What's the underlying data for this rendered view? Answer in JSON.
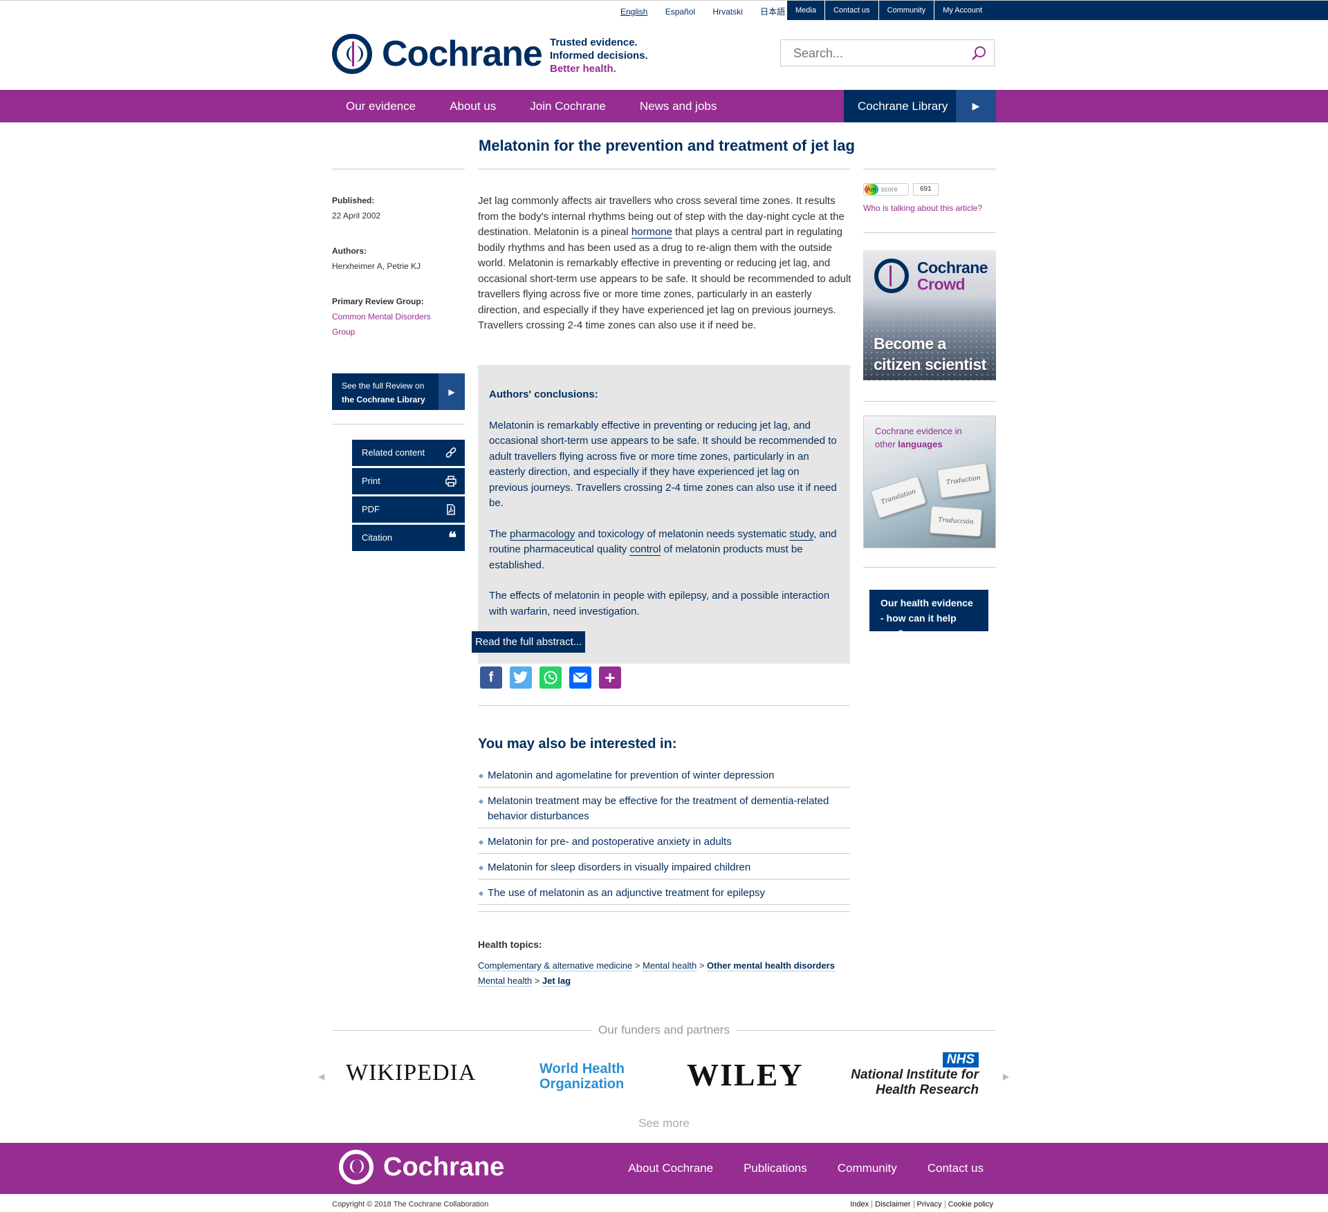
{
  "languages": [
    "English",
    "Español",
    "Hrvatski",
    "日本語"
  ],
  "utility_links": [
    "Media",
    "Contact us",
    "Community",
    "My Account"
  ],
  "header": {
    "brand": "Cochrane",
    "tagline": [
      "Trusted evidence.",
      "Informed decisions.",
      "Better health."
    ],
    "search_placeholder": "Search..."
  },
  "nav": {
    "items": [
      "Our evidence",
      "About us",
      "Join Cochrane",
      "News and jobs"
    ],
    "library": "Cochrane Library"
  },
  "article": {
    "title": "Melatonin for the prevention and treatment of jet lag",
    "published_label": "Published:",
    "published": "22 April 2002",
    "authors_label": "Authors:",
    "authors": "Herxheimer A, Petrie KJ",
    "group_label": "Primary Review Group:",
    "group": "Common Mental Disorders Group",
    "lede_1": "Jet lag commonly affects air travellers who cross several time zones. It results from the body's internal rhythms being out of step with the day-night cycle at the destination. Melatonin is a pineal ",
    "lede_link": "hormone",
    "lede_2": " that plays a central part in regulating bodily rhythms and has been used as a drug to re-align them with the outside world. Melatonin is remarkably effective in preventing or reducing jet lag, and occasional short-term use appears to be safe. It should be recommended to adult travellers flying across five or more time zones, particularly in an easterly direction, and especially if they have experienced jet lag on previous journeys. Travellers crossing 2-4 time zones can also use it if need be."
  },
  "full_review": {
    "line1": "See the full Review on",
    "line2": "the Cochrane Library"
  },
  "tools": [
    "Related content",
    "Print",
    "PDF",
    "Citation"
  ],
  "abstract": {
    "heading": "Authors' conclusions:",
    "p1": "Melatonin is remarkably effective in preventing or reducing jet lag, and occasional short-term use appears to be safe. It should be recommended to adult travellers flying across five or more time zones, particularly in an easterly direction, and especially if they have experienced jet lag on previous journeys. Travellers crossing 2-4 time zones can also use it if need be.",
    "p2_a": "The ",
    "p2_l1": "pharmacology",
    "p2_b": " and toxicology of melatonin needs systematic ",
    "p2_l2": "study",
    "p2_c": ", and routine pharmaceutical quality ",
    "p2_l3": "control",
    "p2_d": " of melatonin products must be established.",
    "p3": "The effects of melatonin in people with epilepsy, and a possible interaction with warfarin, need investigation.",
    "read_more": "Read the full abstract..."
  },
  "interest": {
    "heading": "You may also be interested in:",
    "items": [
      "Melatonin and agomelatine for prevention of winter depression",
      "Melatonin treatment may be effective for the treatment of dementia-related behavior disturbances",
      "Melatonin for pre- and postoperative anxiety in adults",
      "Melatonin for sleep disorders in visually impaired children",
      "The use of melatonin as an adjunctive treatment for epilepsy"
    ]
  },
  "topics": {
    "heading": "Health topics:",
    "row1": [
      "Complementary & alternative medicine",
      "Mental health",
      "Other mental health disorders"
    ],
    "row2": [
      "Mental health",
      "Jet lag"
    ],
    "separator": ">"
  },
  "altmetric": {
    "am": "Am",
    "label": "score",
    "score": "691",
    "question": "Who is talking about this article?"
  },
  "crowd": {
    "brand1": "Cochrane",
    "brand2": "Crowd",
    "line1": "Become a",
    "line2": "citizen scientist"
  },
  "languages_box": {
    "line1": "Cochrane evidence in",
    "line2a": "other ",
    "line2b": "languages",
    "pieces": [
      "Translation",
      "Traduction",
      "Traducción"
    ]
  },
  "help_button": "Our health evidence - how can it help you?",
  "funders": {
    "heading": "Our funders and partners",
    "wikipedia": "WIKIPEDIA",
    "who_1": "World Health",
    "who_2": "Organization",
    "wiley": "WILEY",
    "nhs": "NHS",
    "nihr_1": "National Institute for",
    "nihr_2": "Health Research",
    "see_more": "See more"
  },
  "footer": {
    "brand": "Cochrane",
    "links": [
      "About Cochrane",
      "Publications",
      "Community",
      "Contact us"
    ],
    "copyright": "Copyright © 2018 The Cochrane Collaboration",
    "legal": [
      "Index",
      "Disclaimer",
      "Privacy",
      "Cookie policy"
    ]
  },
  "colors": {
    "navy": "#002d5f",
    "purple": "#962d91",
    "abstract_bg": "#e6e6e6"
  }
}
